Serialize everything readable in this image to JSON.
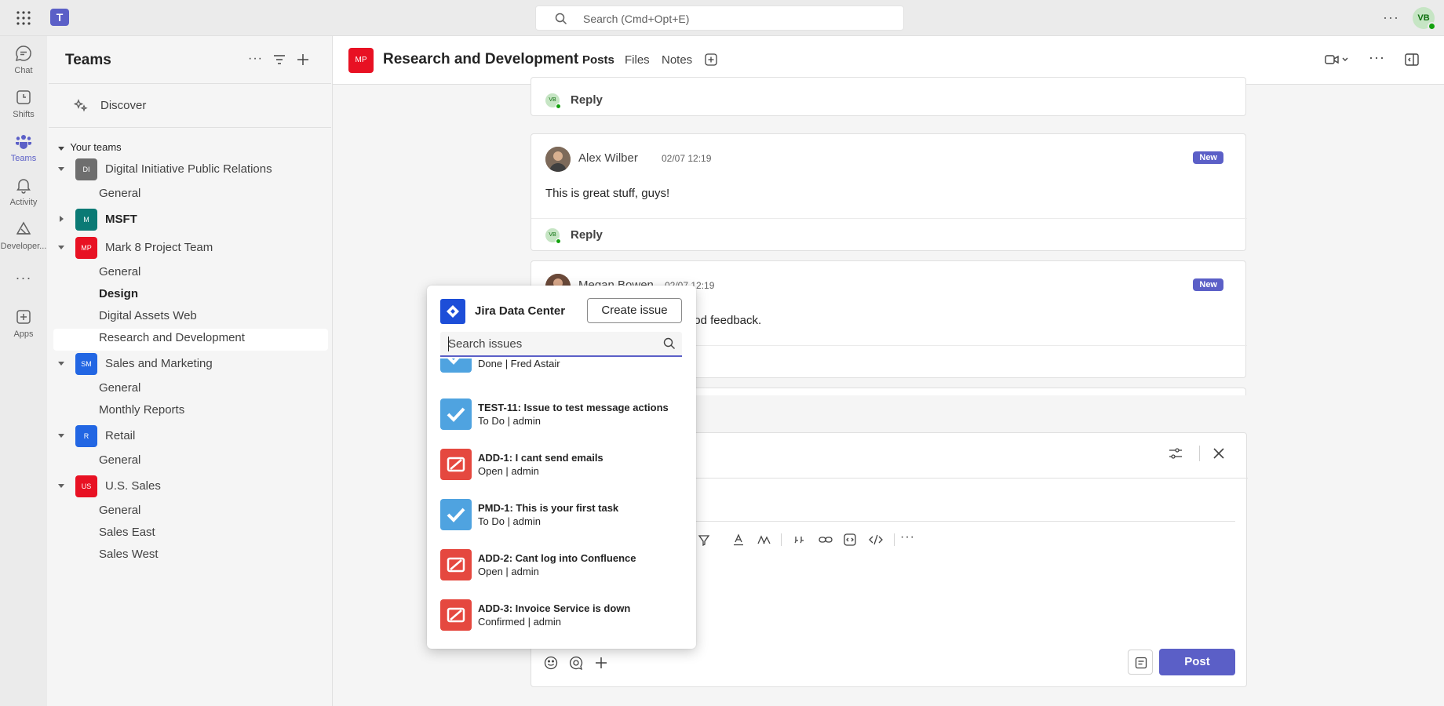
{
  "topbar": {
    "search_placeholder": "Search (Cmd+Opt+E)",
    "avatar_initials": "VB",
    "app_logo_letter": "T"
  },
  "rail": [
    {
      "label": "Chat",
      "icon": "chat-icon"
    },
    {
      "label": "Shifts",
      "icon": "shifts-icon"
    },
    {
      "label": "Teams",
      "icon": "teams-icon",
      "active": true
    },
    {
      "label": "Activity",
      "icon": "bell-icon"
    },
    {
      "label": "Developer...",
      "icon": "developer-icon"
    },
    {
      "label": "Apps",
      "icon": "apps-add-icon"
    }
  ],
  "teams_panel": {
    "title": "Teams",
    "discover": "Discover",
    "your_teams": "Your teams",
    "teams": [
      {
        "initials": "DI",
        "name": "Digital Initiative Public Relations",
        "color": "#6e6e6e",
        "channels": [
          "General"
        ]
      },
      {
        "initials": "M",
        "name": "MSFT",
        "color": "#0b7a75",
        "bold": true,
        "channels": []
      },
      {
        "initials": "MP",
        "name": "Mark 8 Project Team",
        "color": "#e81123",
        "channels": [
          "General",
          "Design",
          "Digital Assets Web",
          "Research and Development"
        ]
      },
      {
        "initials": "SM",
        "name": "Sales and Marketing",
        "color": "#2266e3",
        "channels": [
          "General",
          "Monthly Reports"
        ]
      },
      {
        "initials": "R",
        "name": "Retail",
        "color": "#2266e3",
        "channels": [
          "General"
        ]
      },
      {
        "initials": "US",
        "name": "U.S. Sales",
        "color": "#e81123",
        "channels": [
          "General",
          "Sales East",
          "Sales West"
        ]
      }
    ]
  },
  "channel_header": {
    "initials": "MP",
    "title": "Research and Development",
    "tabs": [
      "Posts",
      "Files",
      "Notes"
    ],
    "active_tab": "Posts"
  },
  "messages": [
    {
      "reply_label": "Reply",
      "reply_initials": "VB"
    },
    {
      "author": "Alex Wilber",
      "time": "02/07 12:19",
      "badge": "New",
      "body": "This is great stuff, guys!",
      "reply_label": "Reply",
      "reply_initials": "VB"
    },
    {
      "author": "Megan Bowen",
      "time": "02/07 12:19",
      "badge": "New",
      "body": "Please make sure we get good feedback."
    }
  ],
  "compose": {
    "post_label": "Post"
  },
  "jira": {
    "title": "Jira Data Center",
    "create_label": "Create issue",
    "search_placeholder": "Search issues",
    "issues": [
      {
        "type": "task",
        "title": "",
        "sub": "Done | Fred Astair"
      },
      {
        "type": "task",
        "title": "TEST-11: Issue to test message actions",
        "sub": "To Do | admin"
      },
      {
        "type": "bug",
        "title": "ADD-1: I cant send emails",
        "sub": "Open | admin"
      },
      {
        "type": "task",
        "title": "PMD-1: This is your first task",
        "sub": "To Do | admin"
      },
      {
        "type": "bug",
        "title": "ADD-2: Cant log into Confluence",
        "sub": "Open | admin"
      },
      {
        "type": "bug",
        "title": "ADD-3: Invoice Service is down",
        "sub": "Confirmed | admin"
      }
    ]
  },
  "colors": {
    "brand": "#5b5fc7",
    "presence_available": "#13a10e"
  }
}
